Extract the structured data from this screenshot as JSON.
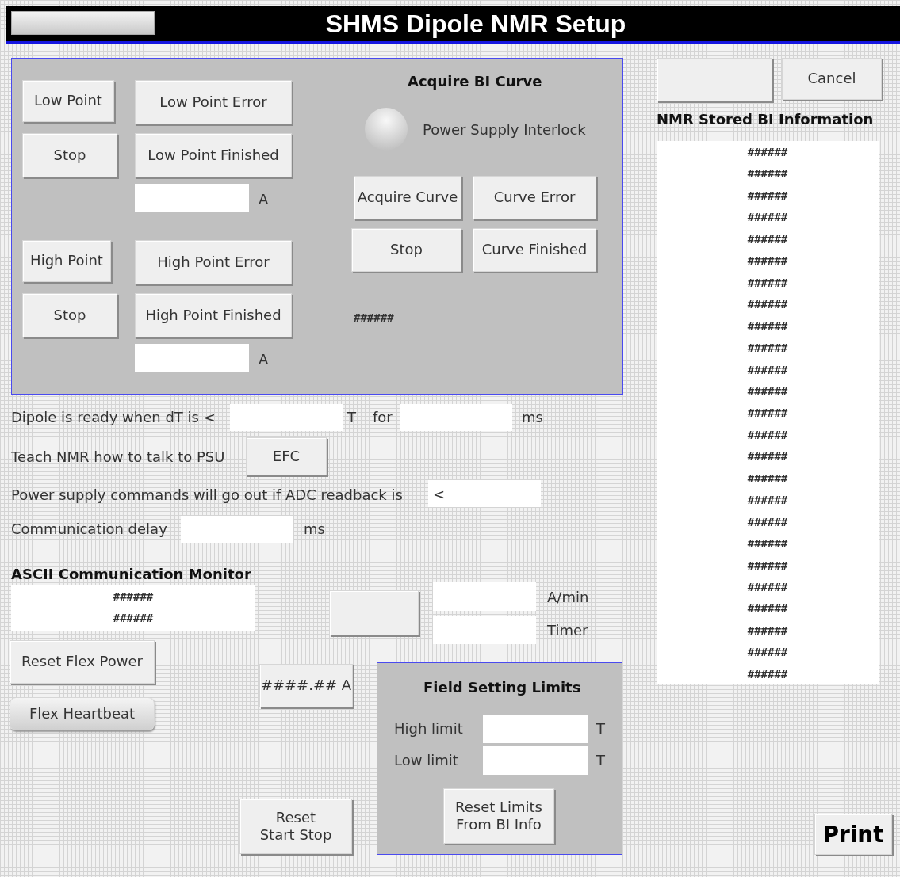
{
  "title_bar": {
    "title": "SHMS Dipole NMR Setup"
  },
  "acquire_panel": {
    "title": "Acquire BI Curve",
    "low_point": {
      "start": "Low Point",
      "stop": "Stop",
      "error": "Low Point Error",
      "finished": "Low Point Finished",
      "unit": "A"
    },
    "high_point": {
      "start": "High Point",
      "stop": "Stop",
      "error": "High Point Error",
      "finished": "High Point Finished",
      "unit": "A"
    },
    "interlock": {
      "label": "Power Supply Interlock",
      "on": false
    },
    "curve": {
      "start": "Acquire Curve",
      "stop": "Stop",
      "error": "Curve Error",
      "finished": "Curve Finished",
      "status": "######"
    }
  },
  "settings": {
    "ready_label": "Dipole is ready when dT is <",
    "ready_unit": "T",
    "for_label": "for",
    "for_unit": "ms",
    "teach_label": "Teach NMR how to talk to PSU",
    "teach_button": "EFC",
    "adc_label": "Power supply commands will go out if ADC readback is",
    "adc_value": "<",
    "delay_label": "Communication delay",
    "delay_unit": "ms"
  },
  "ascii_monitor": {
    "title": "ASCII Communication Monitor",
    "lines": [
      "######",
      "######"
    ]
  },
  "ramp": {
    "rate_unit": "A/min",
    "timer_label": "Timer"
  },
  "flex": {
    "reset": "Reset Flex Power",
    "heartbeat": "Flex Heartbeat"
  },
  "current_button": "####.## A",
  "reset_start_stop": [
    "Reset",
    "Start Stop"
  ],
  "limits": {
    "title": "Field Setting Limits",
    "high_label": "High limit",
    "high_unit": "T",
    "low_label": "Low limit",
    "low_unit": "T",
    "reset": [
      "Reset Limits",
      "From BI Info"
    ]
  },
  "cancel_button": "Cancel",
  "stored_info": {
    "title": "NMR Stored BI Information",
    "entries": [
      "######",
      "######",
      "######",
      "######",
      "######",
      "######",
      "######",
      "######",
      "######",
      "######",
      "######",
      "######",
      "######",
      "######",
      "######",
      "######",
      "######",
      "######",
      "######",
      "######",
      "######",
      "######",
      "######",
      "######",
      "######"
    ]
  },
  "print_button": "Print"
}
